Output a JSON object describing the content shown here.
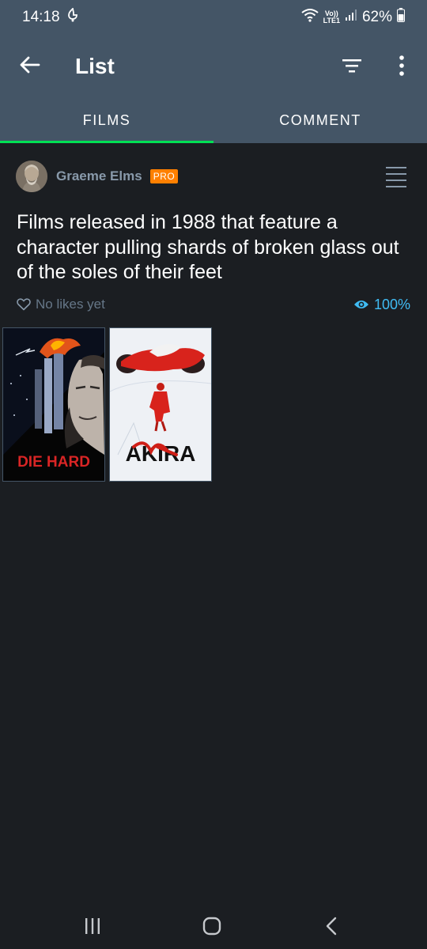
{
  "status": {
    "time": "14:18",
    "network_top": "Vo))",
    "network_bottom": "LTE1",
    "battery": "62%"
  },
  "appbar": {
    "title": "List"
  },
  "tabs": [
    {
      "label": "FILMS",
      "active": true
    },
    {
      "label": "COMMENT",
      "active": false
    }
  ],
  "author": {
    "name": "Graeme Elms",
    "badge": "PRO"
  },
  "list": {
    "title": "Films released in 1988 that feature a character pulling shards of broken glass out of the soles of their feet",
    "likes": "No likes yet",
    "watched": "100%"
  },
  "films": [
    {
      "poster_text": "DIE HARD"
    },
    {
      "poster_text": "AKIRA"
    }
  ],
  "colors": {
    "header": "#445566",
    "background": "#1b1e22",
    "accent_green": "#00e054",
    "badge_orange": "#ff8000",
    "watched_blue": "#40bcf4"
  }
}
